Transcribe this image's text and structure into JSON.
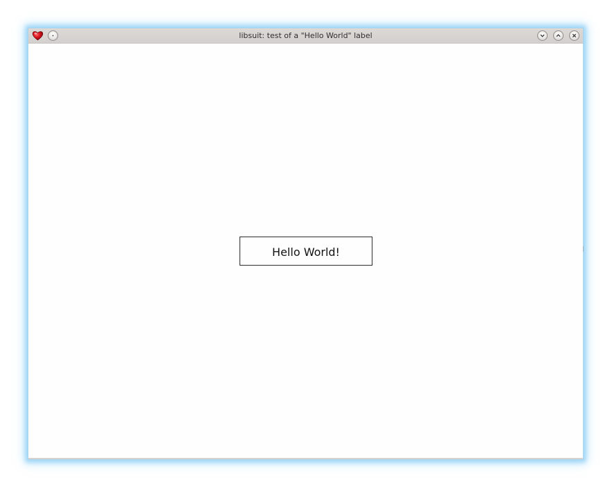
{
  "window": {
    "title": "libsuit: test of a \"Hello World\" label",
    "app_icon": "heart-icon",
    "buttons": {
      "menu": "menu-dot-icon",
      "minimize": "chevron-down-icon",
      "maximize": "chevron-up-icon",
      "close": "close-icon"
    }
  },
  "content": {
    "label_text": "Hello World!"
  },
  "colors": {
    "window_glow": "#9fd6f7",
    "titlebar": "#d8d5d2",
    "heart": "#c8141c",
    "label_border": "#2a2a2a"
  }
}
